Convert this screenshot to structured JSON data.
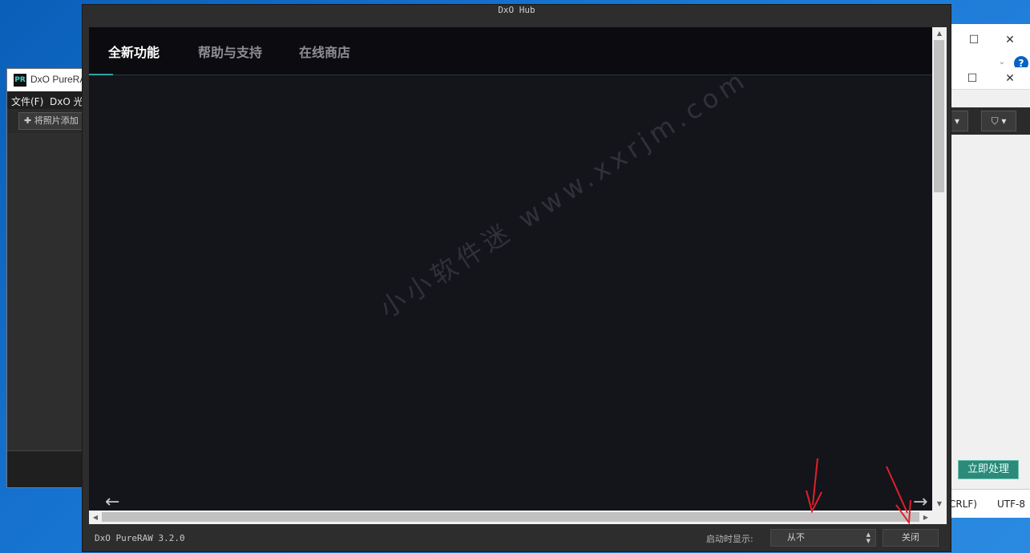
{
  "hub": {
    "title": "DxO Hub",
    "tabs": [
      {
        "label": "全新功能",
        "active": true
      },
      {
        "label": "帮助与支持",
        "active": false
      },
      {
        "label": "在线商店",
        "active": false
      }
    ],
    "watermark": "小小软件迷 www.xxrjm.com",
    "nav": {
      "prev_icon": "←",
      "next_icon": "→"
    },
    "footer": {
      "version": "DxO PureRAW 3.2.0",
      "startup_label": "启动时显示:",
      "startup_value": "从不",
      "close_label": "关闭"
    }
  },
  "background_left": {
    "logo": "PR",
    "app_title": "DxO PureRAW",
    "menu": [
      "文件(F)",
      "DxO 光学"
    ],
    "add_photos": "将照片添加"
  },
  "background_right": {
    "process_button": "立即处理",
    "status": [
      "CRLF)",
      "UTF-8"
    ],
    "help": "?"
  },
  "colors": {
    "accent": "#2aa7a0",
    "annotation_arrow": "#e0202a",
    "content_bg": "#14141b"
  }
}
